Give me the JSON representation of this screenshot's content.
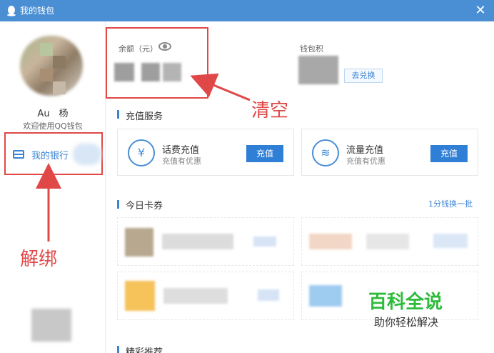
{
  "window": {
    "title": "我的钱包"
  },
  "sidebar": {
    "username": "Au 杨",
    "welcome": "欢迎使用QQ钱包",
    "item_label": "我的银行"
  },
  "balance": {
    "label": "余额（元）"
  },
  "points": {
    "label": "钱包积",
    "redeem_label": "去兑换"
  },
  "recharge": {
    "section_title": "充值服务",
    "cards": [
      {
        "title": "话费充值",
        "subtitle": "充值有优惠",
        "button": "充值",
        "icon": "phone-bill-icon"
      },
      {
        "title": "流量充值",
        "subtitle": "充值有优惠",
        "button": "充值",
        "icon": "data-traffic-icon"
      }
    ]
  },
  "coupons": {
    "section_title": "今日卡券",
    "exchange_link": "1分钱换一批"
  },
  "bottom_section": {
    "title": "精彩推荐"
  },
  "annotations": {
    "clear": "清空",
    "unbind": "解绑"
  },
  "watermark": {
    "title": "百科全说",
    "subtitle": "助你轻松解决"
  },
  "colors": {
    "titlebar": "#4a8fd4",
    "accent": "#2f7fd6",
    "annotation": "#e04848",
    "watermark": "#2dbb3b"
  }
}
